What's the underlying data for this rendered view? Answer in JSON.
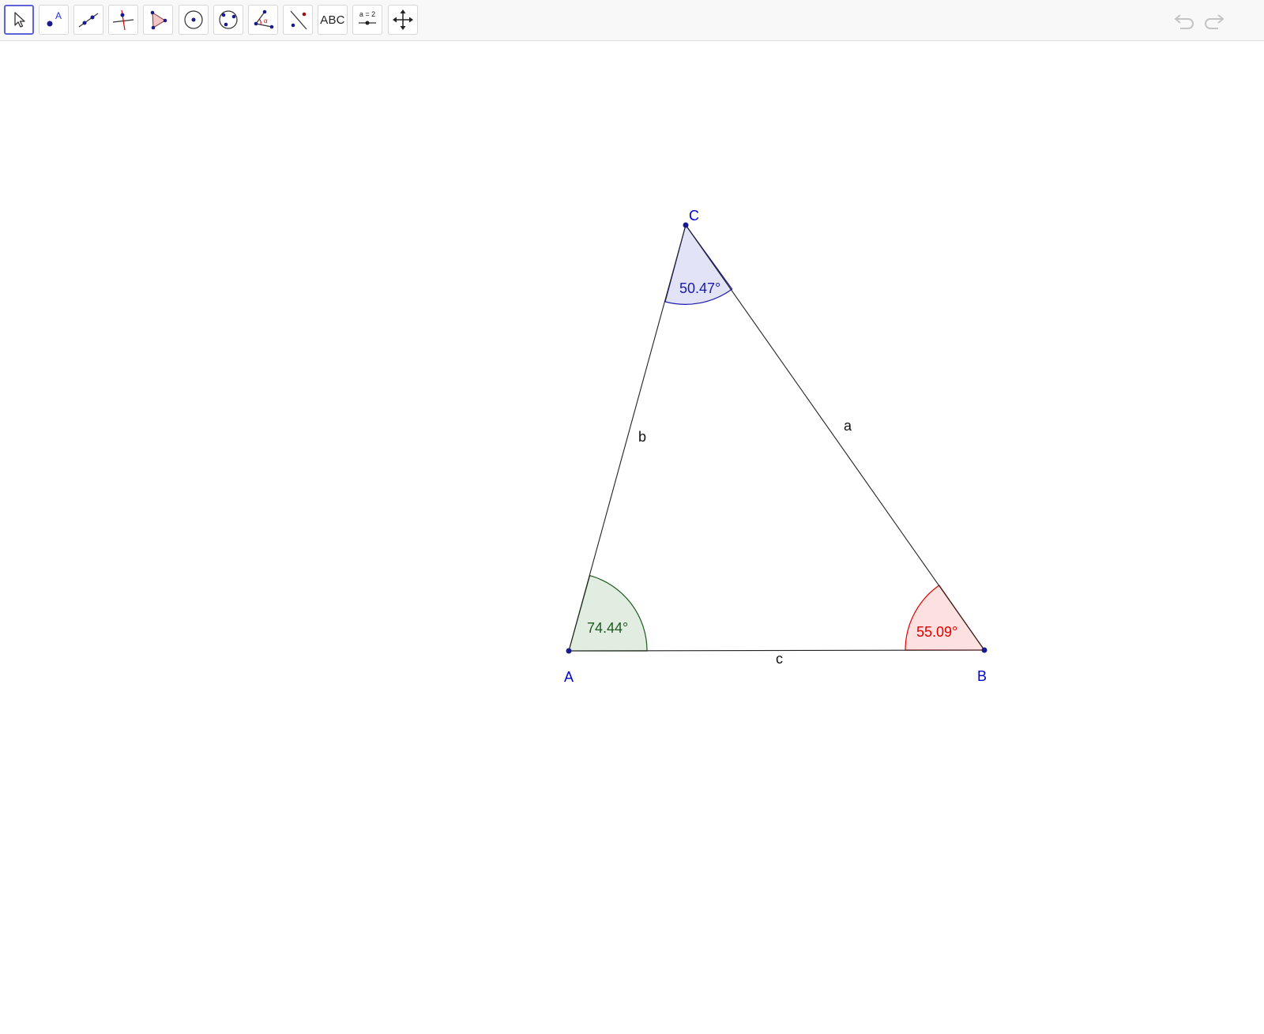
{
  "toolbar": {
    "tools": [
      {
        "name": "Move",
        "icon": "cursor-arrow-icon"
      },
      {
        "name": "Point",
        "icon": "point-icon",
        "glyph": "A"
      },
      {
        "name": "Line",
        "icon": "line-through-two-points-icon"
      },
      {
        "name": "Perpendicular Line",
        "icon": "perpendicular-line-icon"
      },
      {
        "name": "Polygon",
        "icon": "polygon-icon"
      },
      {
        "name": "Circle with Center through Point",
        "icon": "circle-center-point-icon"
      },
      {
        "name": "Circle through 3 Points",
        "icon": "circle-three-points-icon"
      },
      {
        "name": "Angle",
        "icon": "angle-icon",
        "glyph": "α"
      },
      {
        "name": "Reflect about Line",
        "icon": "reflect-about-line-icon"
      },
      {
        "name": "Text",
        "icon": "text-icon",
        "label": "ABC"
      },
      {
        "name": "Slider",
        "icon": "slider-icon",
        "label": "a = 2"
      },
      {
        "name": "Move Graphics View",
        "icon": "move-graphics-view-icon"
      }
    ],
    "selected_tool": "Move",
    "undo": "undo-icon",
    "redo": "redo-icon"
  },
  "geometry": {
    "points": {
      "A": {
        "label": "A",
        "color": "#0000cc"
      },
      "B": {
        "label": "B",
        "color": "#0000cc"
      },
      "C": {
        "label": "C",
        "color": "#0000cc"
      }
    },
    "segments": {
      "a": {
        "label": "a"
      },
      "b": {
        "label": "b"
      },
      "c": {
        "label": "c"
      }
    },
    "angles": {
      "A": {
        "value": "74.44°",
        "color": "#1e5a1e",
        "fill": "#e2ede2"
      },
      "B": {
        "value": "55.09°",
        "color": "#e00000",
        "fill": "#fde0e0"
      },
      "C": {
        "value": "50.47°",
        "color": "#1a1aa8",
        "fill": "#e3e3f7"
      }
    }
  }
}
